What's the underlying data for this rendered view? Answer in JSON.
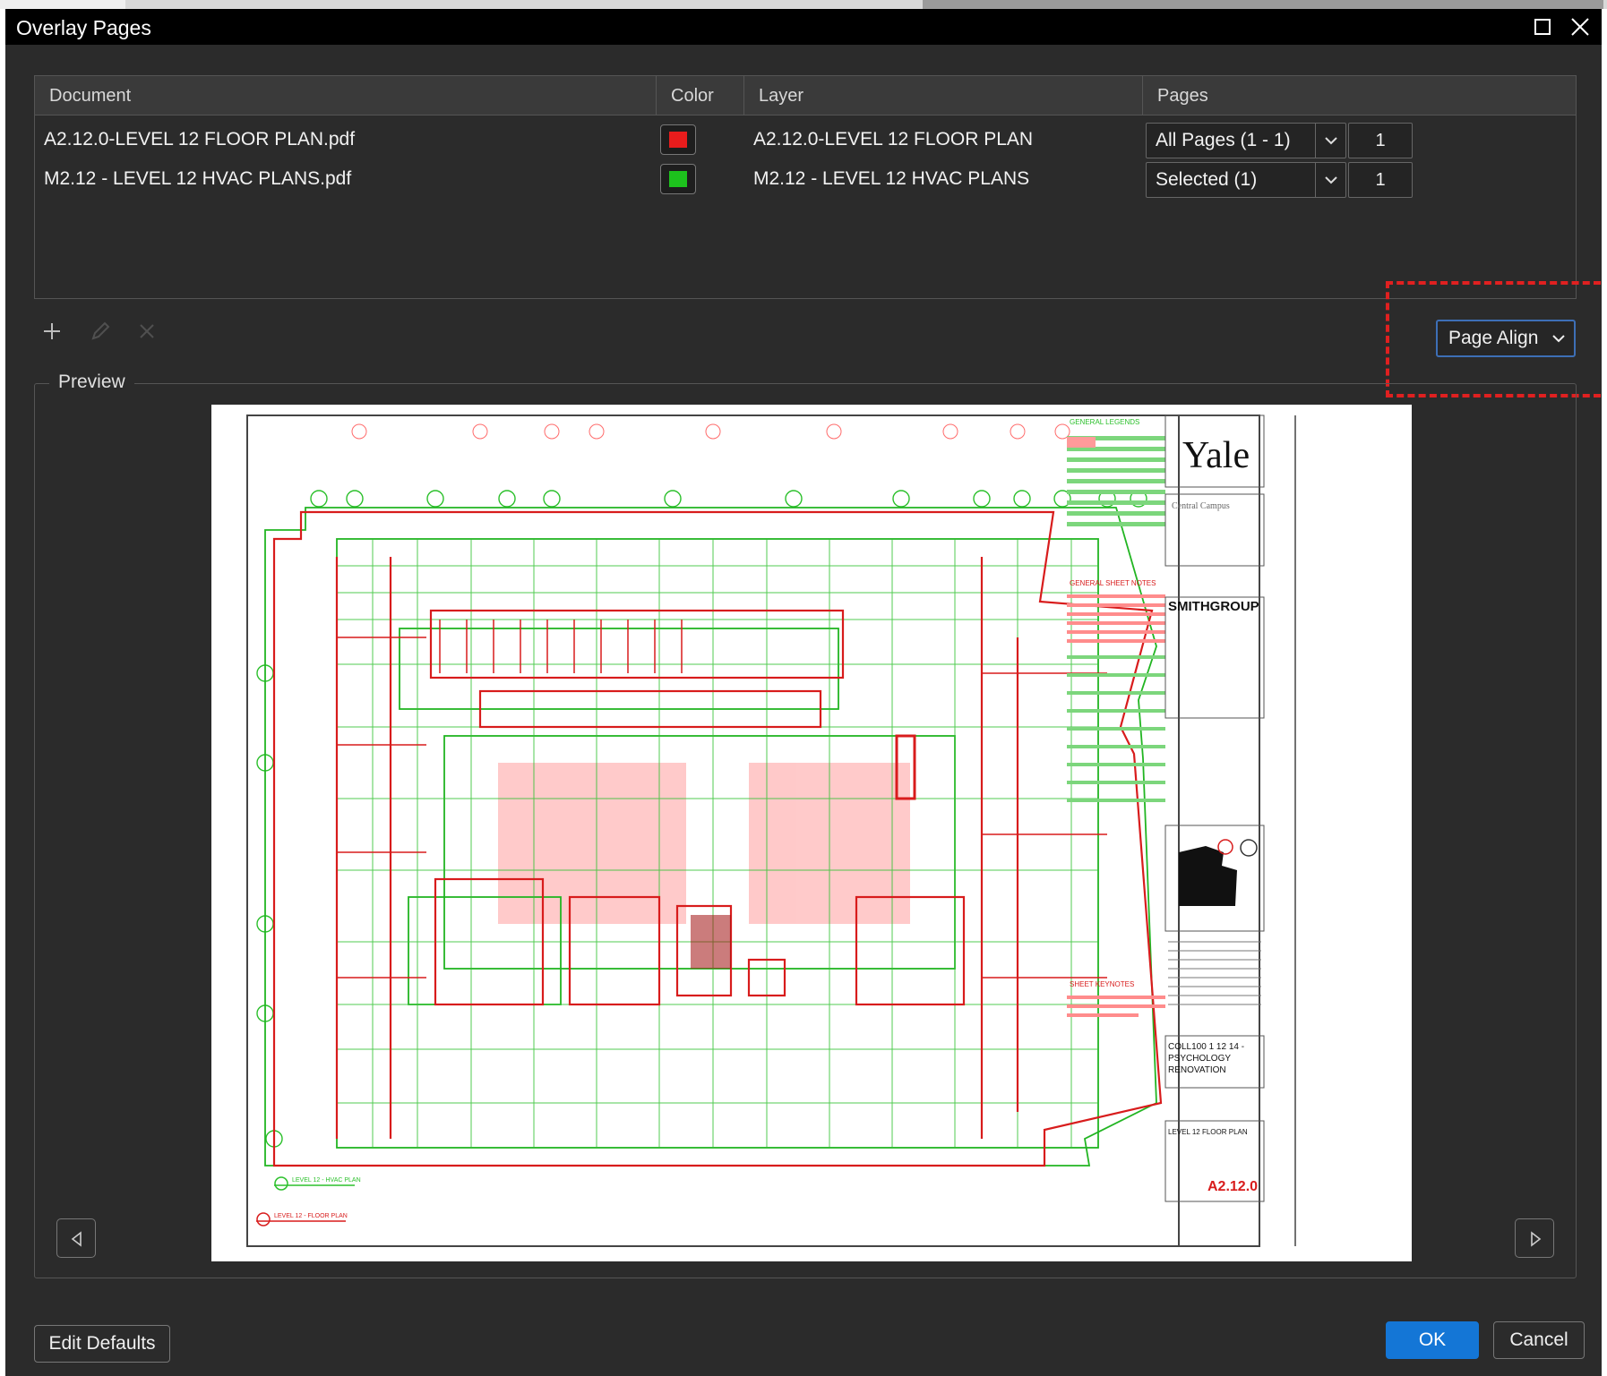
{
  "window": {
    "title": "Overlay Pages"
  },
  "table": {
    "columns": [
      "Document",
      "Color",
      "Layer",
      "Pages"
    ],
    "rows": [
      {
        "document": "A2.12.0-LEVEL 12 FLOOR PLAN.pdf",
        "color": "#e81c1c",
        "layer": "A2.12.0-LEVEL 12 FLOOR PLAN",
        "pages": "All Pages (1 - 1)",
        "page_number": "1"
      },
      {
        "document": "M2.12 - LEVEL 12 HVAC PLANS.pdf",
        "color": "#1dc21d",
        "layer": "M2.12 - LEVEL 12 HVAC PLANS",
        "pages": "Selected (1)",
        "page_number": "1"
      }
    ]
  },
  "toolbar": {
    "icons": [
      "plus-icon",
      "pencil-icon",
      "delete-icon"
    ]
  },
  "alignment": {
    "value": "Page Align"
  },
  "preview": {
    "label": "Preview",
    "sheet": {
      "client": "Yale",
      "campus": "Central Campus",
      "firm": "SMITHGROUP",
      "general_legend": "GENERAL LEGENDS",
      "general_notes": "GENERAL SHEET NOTES",
      "keynotes": "SHEET KEYNOTES",
      "project_line1": "COLL100 1 12 14 -",
      "project_line2": "PSYCHOLOGY",
      "project_line3": "RENOVATION",
      "sheet_title": "LEVEL 12 FLOOR PLAN",
      "sheet_number": "A2.12.0",
      "legend_floor": "LEVEL 12 - FLOOR PLAN",
      "legend_hvac": "LEVEL 12 - HVAC PLAN"
    }
  },
  "footer": {
    "edit_defaults": "Edit Defaults",
    "ok": "OK",
    "cancel": "Cancel"
  }
}
